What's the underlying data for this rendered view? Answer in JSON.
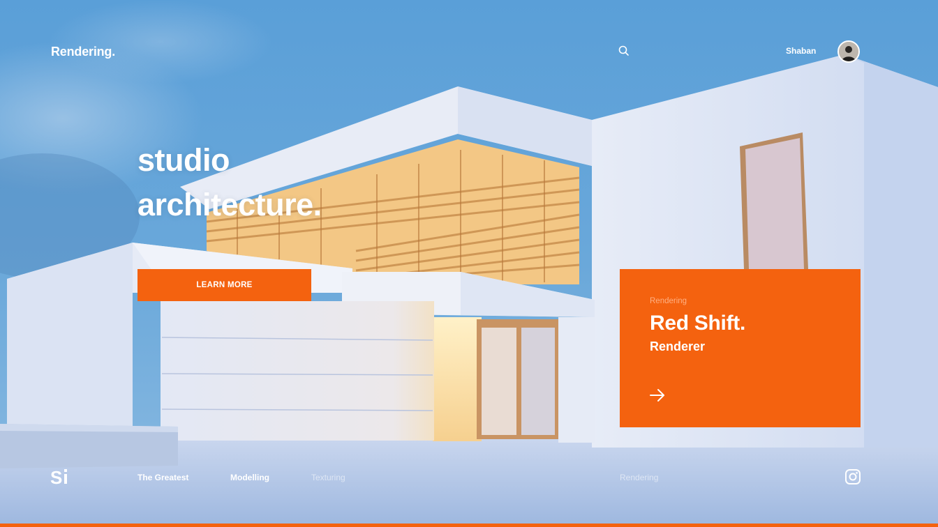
{
  "header": {
    "logo": "Rendering.",
    "search_icon": "search-icon",
    "user_name": "Shaban",
    "avatar_icon": "avatar"
  },
  "hero": {
    "title_line1": "studio",
    "title_line2": "architecture.",
    "cta_label": "LEARN MORE"
  },
  "card": {
    "eyebrow": "Rendering",
    "title": "Red Shift.",
    "subtitle": "Renderer",
    "arrow_icon": "arrow-right-icon"
  },
  "footer": {
    "brand_icon": "si-logo-icon",
    "nav": [
      {
        "label": "The Greatest",
        "state": "active"
      },
      {
        "label": "Modelling",
        "state": "active"
      },
      {
        "label": "Texturing",
        "state": "dim"
      },
      {
        "label": "Rendering",
        "state": "dim"
      }
    ],
    "social_icon": "instagram-icon"
  },
  "colors": {
    "accent": "#f4620f",
    "sky": "#5f9fd4",
    "text": "#ffffff"
  }
}
